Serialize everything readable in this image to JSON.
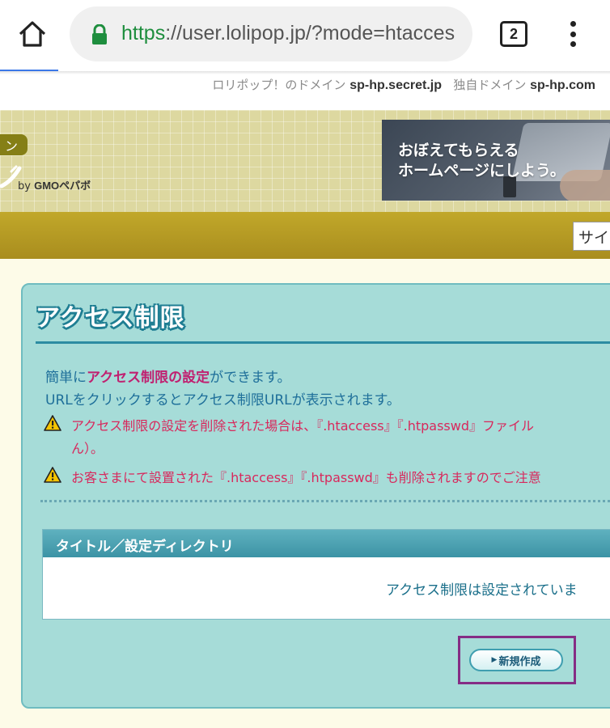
{
  "browser": {
    "url_scheme": "https",
    "url_rest": "://user.lolipop.jp/?mode=htacces",
    "tab_count": "2"
  },
  "domain_bar": {
    "lolipop_label": "ロリポップ！のドメイン",
    "lolipop_domain": "sp-hp.secret.jp",
    "custom_label": "独自ドメイン",
    "custom_domain": "sp-hp.com"
  },
  "header": {
    "logo_tag": "ン",
    "logo_by": "by",
    "logo_brand": "GMOペパボ",
    "promo_line1": "おぼえてもらえる",
    "promo_line2": "ホームページにしよう。"
  },
  "nav": {
    "search_placeholder": "サイ"
  },
  "panel": {
    "title": "アクセス制限",
    "desc1_a": "簡単に",
    "desc1_b": "アクセス制限の設定",
    "desc1_c": "ができます。",
    "desc2": "URLをクリックするとアクセス制限URLが表示されます。",
    "warn1_line1": "アクセス制限の設定を削除された場合は、『.htaccess』『.htpasswd』ファイル",
    "warn1_line2": "ん）。",
    "warn2": "お客さまにて設置された『.htaccess』『.htpasswd』も削除されますのでご注意"
  },
  "table": {
    "header": "タイトル／設定ディレクトリ",
    "empty_message": "アクセス制限は設定されていま"
  },
  "actions": {
    "new_label": "新規作成"
  },
  "colors": {
    "panel_bg": "#a6dcd8",
    "accent_teal": "#2c8ca2",
    "warning_pink": "#d8285c",
    "nav_gold": "#b39a24",
    "highlight_purple": "#852d85"
  }
}
